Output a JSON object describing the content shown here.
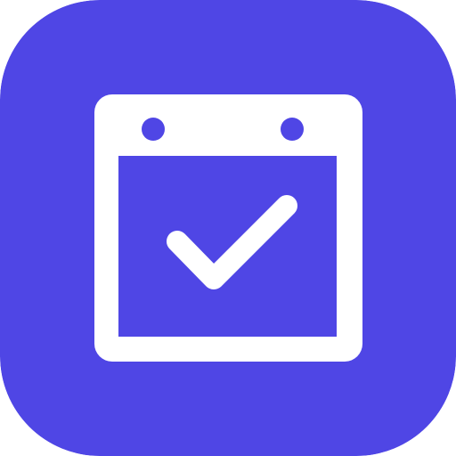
{
  "icon": {
    "name": "calendar-check-icon",
    "background_color": "#4F46E5",
    "foreground_color": "#FFFFFF"
  }
}
